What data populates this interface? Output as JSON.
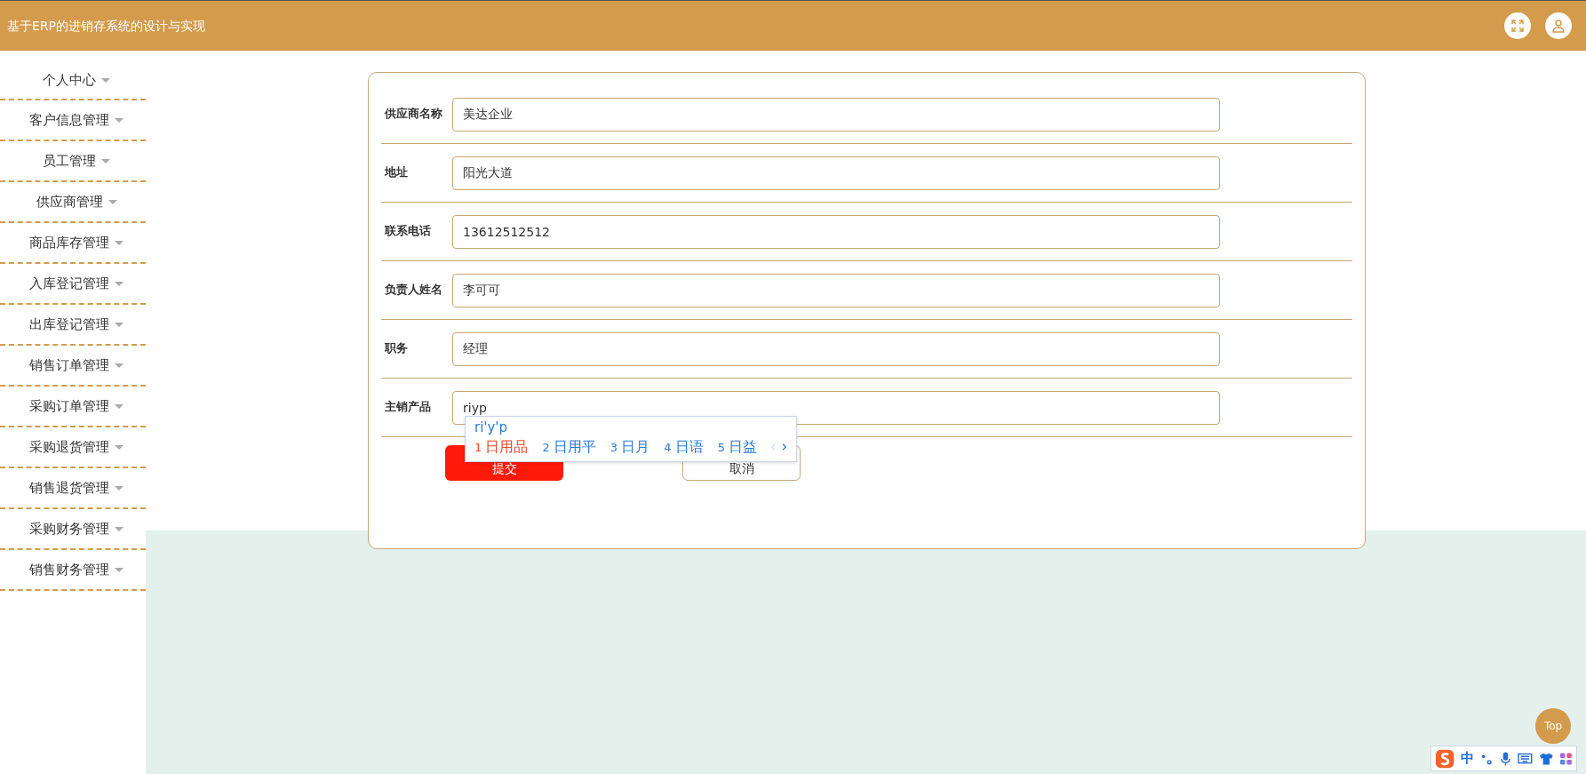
{
  "header": {
    "title": "基于ERP的进销存系统的设计与实现"
  },
  "sidebar": {
    "items": [
      {
        "label": "个人中心"
      },
      {
        "label": "客户信息管理"
      },
      {
        "label": "员工管理"
      },
      {
        "label": "供应商管理"
      },
      {
        "label": "商品库存管理"
      },
      {
        "label": "入库登记管理"
      },
      {
        "label": "出库登记管理"
      },
      {
        "label": "销售订单管理"
      },
      {
        "label": "采购订单管理"
      },
      {
        "label": "采购退货管理"
      },
      {
        "label": "销售退货管理"
      },
      {
        "label": "采购财务管理"
      },
      {
        "label": "销售财务管理"
      }
    ]
  },
  "form": {
    "fields": [
      {
        "label": "供应商名称",
        "value": "美达企业"
      },
      {
        "label": "地址",
        "value": "阳光大道"
      },
      {
        "label": "联系电话",
        "value": "13612512512"
      },
      {
        "label": "负责人姓名",
        "value": "李可可"
      },
      {
        "label": "职务",
        "value": "经理"
      },
      {
        "label": "主销产品",
        "value": "riyp"
      }
    ],
    "buttons": [
      {
        "label": "提交",
        "kind": "primary"
      },
      {
        "label": "取消",
        "kind": "secondary"
      }
    ]
  },
  "ime_popup": {
    "composition": "ri'y'p",
    "candidates": [
      {
        "number": "1",
        "text": "日用品",
        "selected": true
      },
      {
        "number": "2",
        "text": "日用平",
        "selected": false
      },
      {
        "number": "3",
        "text": "日月",
        "selected": false
      },
      {
        "number": "4",
        "text": "日语",
        "selected": false
      },
      {
        "number": "5",
        "text": "日益",
        "selected": false
      }
    ]
  },
  "top_button": {
    "label": "Top"
  },
  "ime_toolbar": {
    "mode": "中"
  }
}
